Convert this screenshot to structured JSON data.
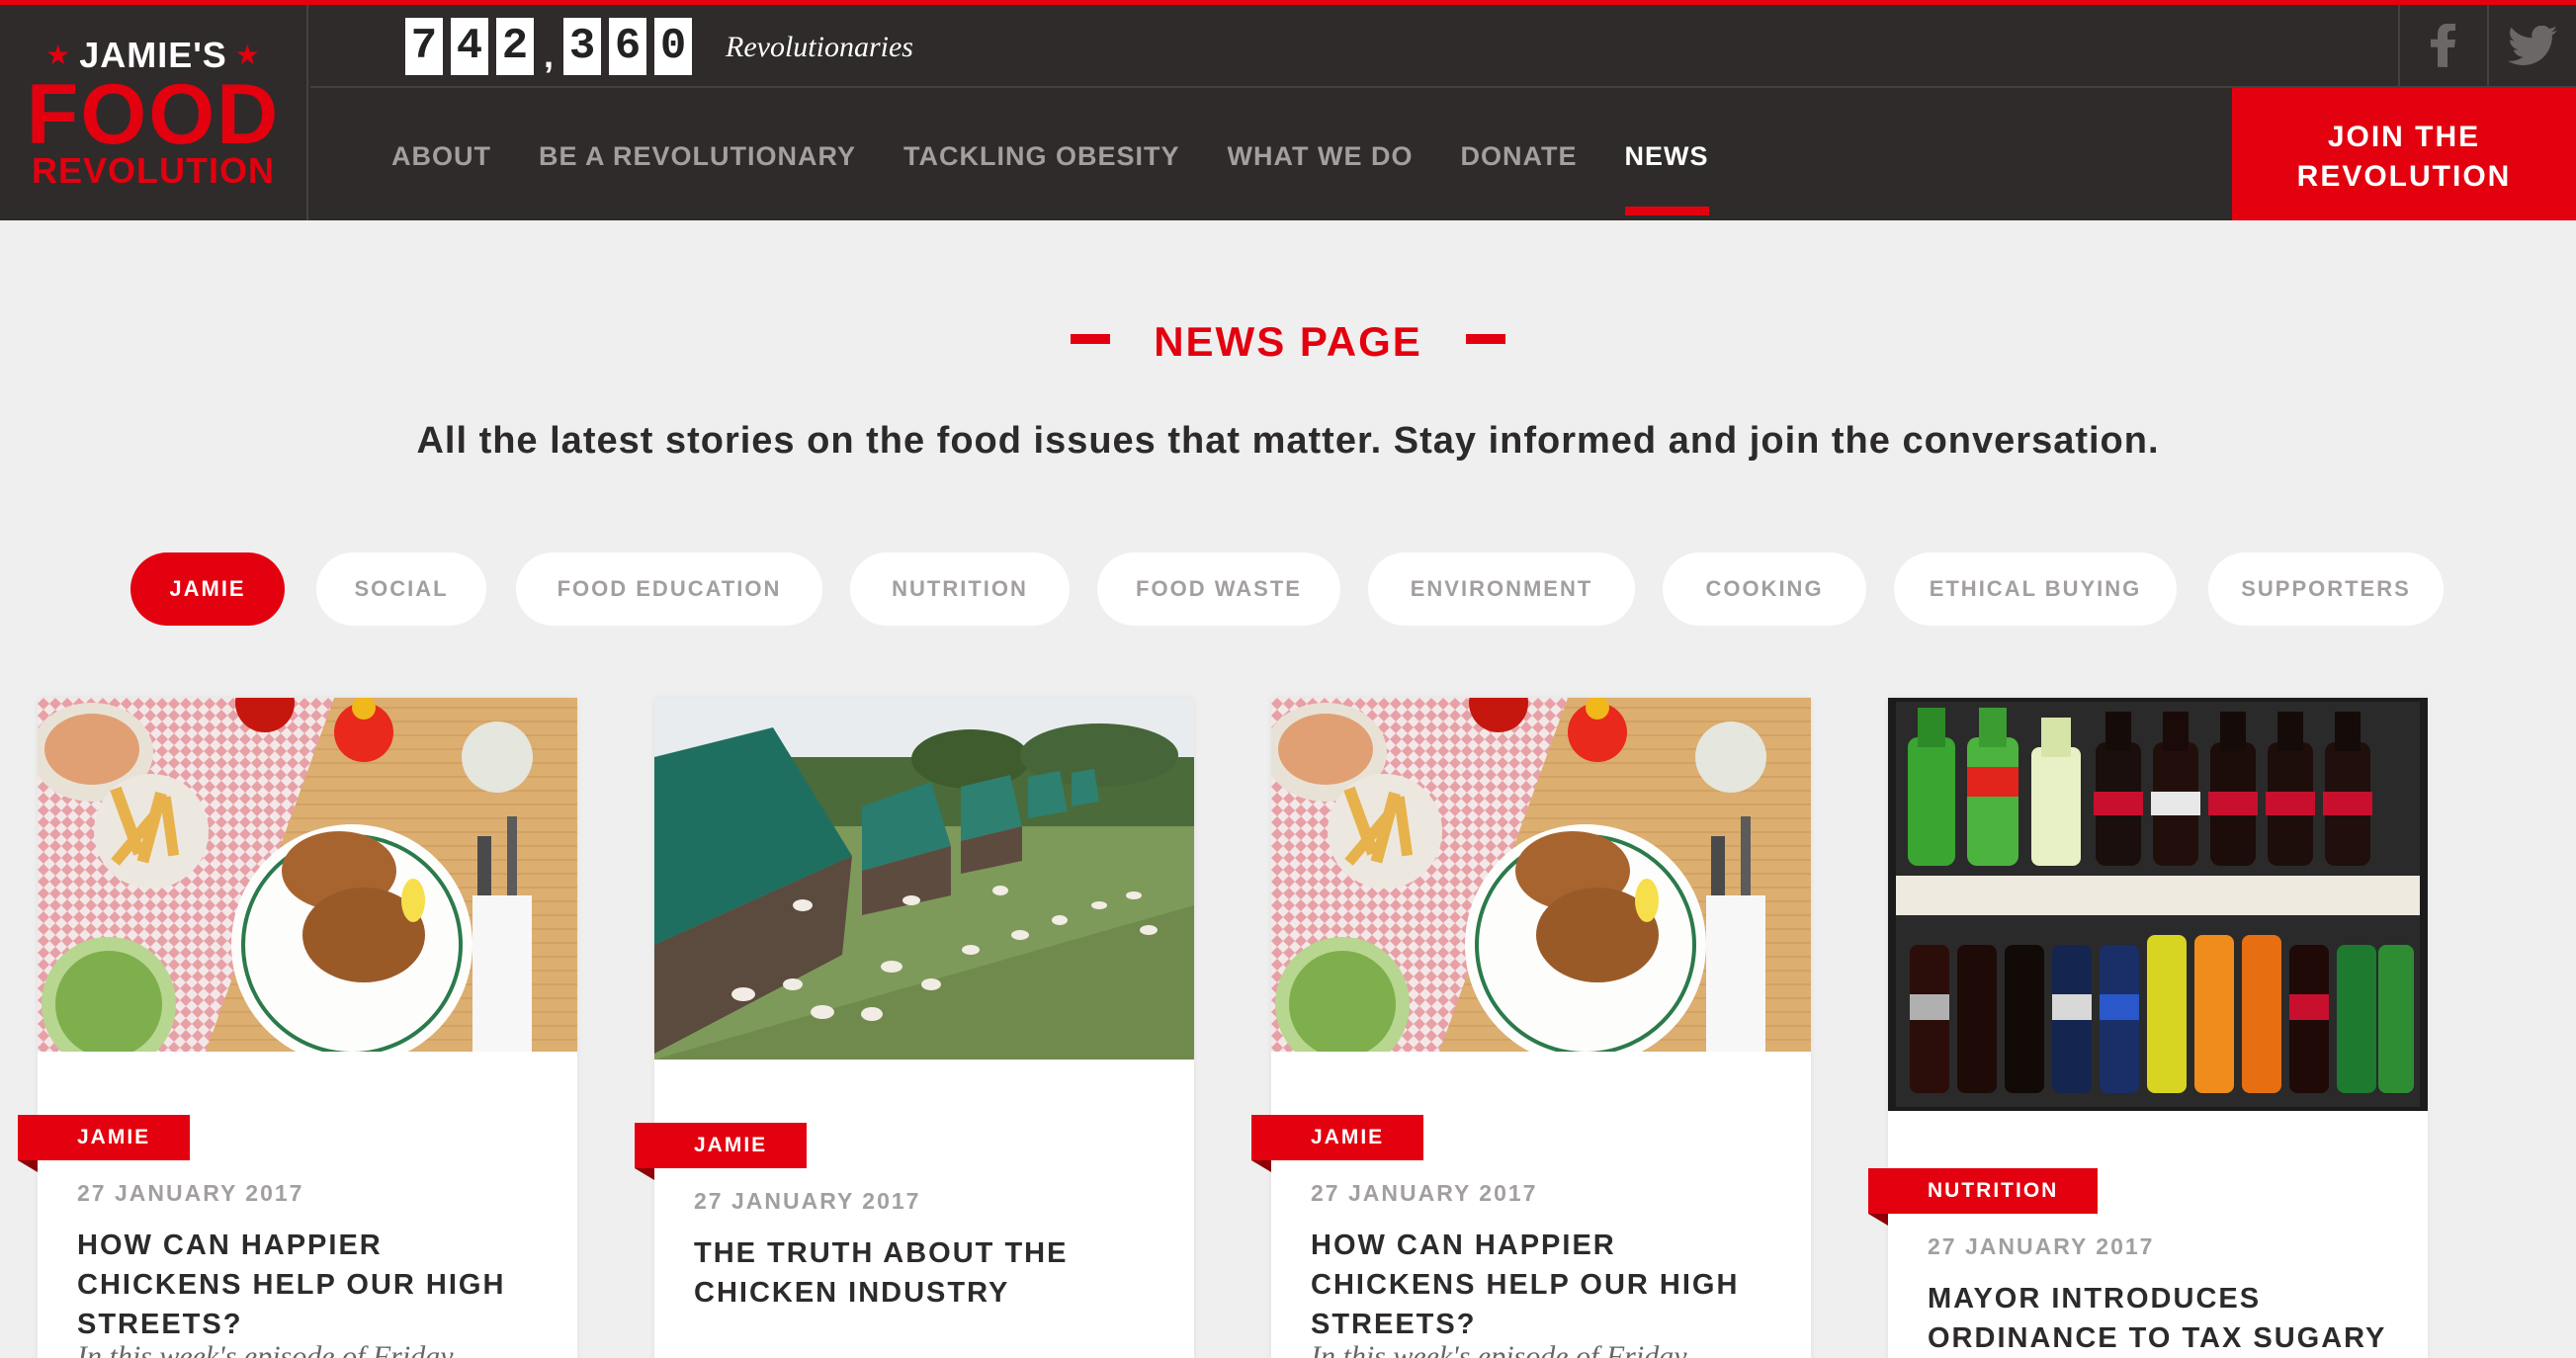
{
  "brand": {
    "line1": "JAMIE'S",
    "line2": "FOOD",
    "line3": "REVOLUTION",
    "accent": "#e3000f",
    "dark": "#2f2b2a"
  },
  "counter": {
    "digits": [
      "7",
      "4",
      "2",
      "3",
      "6",
      "0"
    ],
    "separator": ",",
    "label": "Revolutionaries"
  },
  "social": [
    {
      "icon": "facebook-icon"
    },
    {
      "icon": "twitter-icon"
    }
  ],
  "nav": {
    "items": [
      "ABOUT",
      "BE A REVOLUTIONARY",
      "TACKLING OBESITY",
      "WHAT WE DO",
      "DONATE",
      "NEWS"
    ],
    "active": "NEWS",
    "cta": "JOIN THE REVOLUTION"
  },
  "hero": {
    "heading": "NEWS PAGE",
    "intro": "All the latest stories on the food issues that matter. Stay informed and join the conversation."
  },
  "filters": {
    "items": [
      "JAMIE",
      "SOCIAL",
      "FOOD EDUCATION",
      "NUTRITION",
      "FOOD WASTE",
      "ENVIRONMENT",
      "COOKING",
      "ETHICAL BUYING",
      "SUPPORTERS"
    ],
    "active": "JAMIE"
  },
  "cards": [
    {
      "tag": "JAMIE",
      "date": "27 JANUARY 2017",
      "title": "HOW CAN HAPPIER CHICKENS HELP OUR HIGH STREETS?",
      "excerpt": "In this week's episode of Friday...",
      "image": "roast-chicken-plate"
    },
    {
      "tag": "JAMIE",
      "date": "27 JANUARY 2017",
      "title": "THE TRUTH ABOUT THE CHICKEN INDUSTRY",
      "excerpt": "",
      "image": "free-range-chicken-farm"
    },
    {
      "tag": "JAMIE",
      "date": "27 JANUARY 2017",
      "title": "HOW CAN HAPPIER CHICKENS HELP OUR HIGH STREETS?",
      "excerpt": "In this week's episode of Friday...",
      "image": "roast-chicken-plate"
    },
    {
      "tag": "NUTRITION",
      "date": "27 JANUARY 2017",
      "title": "MAYOR INTRODUCES ORDINANCE TO TAX SUGARY",
      "excerpt": "",
      "image": "soda-fridge"
    }
  ]
}
